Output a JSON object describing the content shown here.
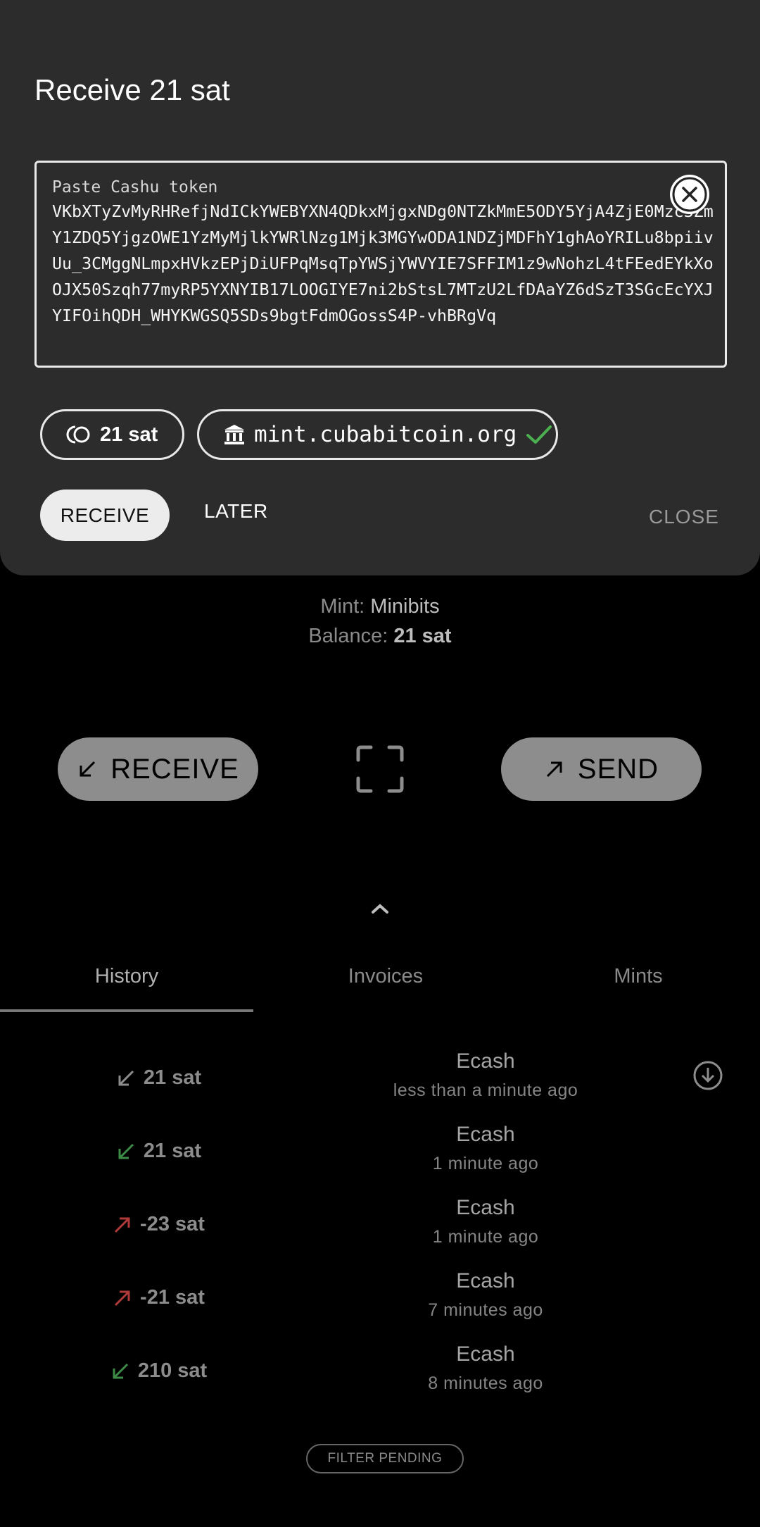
{
  "wallet": {
    "mint_label": "Mint:",
    "mint_name": "Minibits",
    "balance_label": "Balance:",
    "balance_value": "21 sat"
  },
  "actions": {
    "receive_label": "RECEIVE",
    "send_label": "SEND"
  },
  "tabs": [
    {
      "label": "History",
      "active": true
    },
    {
      "label": "Invoices",
      "active": false
    },
    {
      "label": "Mints",
      "active": false
    }
  ],
  "history": [
    {
      "amount": "21 sat",
      "direction": "in",
      "status": "pending",
      "title": "Ecash",
      "time": "less than a minute ago",
      "icon": "download-circle-icon"
    },
    {
      "amount": "21 sat",
      "direction": "in",
      "status": "done",
      "title": "Ecash",
      "time": "1 minute ago"
    },
    {
      "amount": "-23 sat",
      "direction": "out",
      "status": "done",
      "title": "Ecash",
      "time": "1 minute ago"
    },
    {
      "amount": "-21 sat",
      "direction": "out",
      "status": "done",
      "title": "Ecash",
      "time": "7 minutes ago"
    },
    {
      "amount": "210 sat",
      "direction": "in",
      "status": "done",
      "title": "Ecash",
      "time": "8 minutes ago"
    }
  ],
  "filter_label": "FILTER PENDING",
  "dialog": {
    "title": "Receive 21 sat",
    "token_label": "Paste Cashu token",
    "token_value": "VKbXTyZvMyRHRefjNdICkYWEBYXN4QDkxMjgxNDg0NTZkMmE5ODY5YjA4ZjE0Mzc3ZmY1ZDQ5YjgzOWE1YzMyMjlkYWRlNzg1Mjk3MGYwODA1NDZjMDFhY1ghAoYRILu8bpiivUu_3CMggNLmpxHVkzEPjDiUFPqMsqTpYWSjYWVYIE7SFFIM1z9wNohzL4tFEedEYkXoOJX50Szqh77myRP5YXNYIB17LOOGIYE7ni2bStsL7MTzU2LfDAaYZ6dSzT3SGcEcYXJYIFOihQDH_WHYKWGSQ5SDs9bgtFdmOGossS4P-vhBRgVq",
    "amount_chip": "21 sat",
    "mint_chip": "mint.cubabitcoin.org",
    "receive_label": "RECEIVE",
    "later_label": "LATER",
    "close_label": "CLOSE"
  },
  "colors": {
    "sheet_bg": "#2c2c2c",
    "incoming": "#3d8b45",
    "outgoing": "#b03a3a",
    "verified": "#4caf50"
  }
}
